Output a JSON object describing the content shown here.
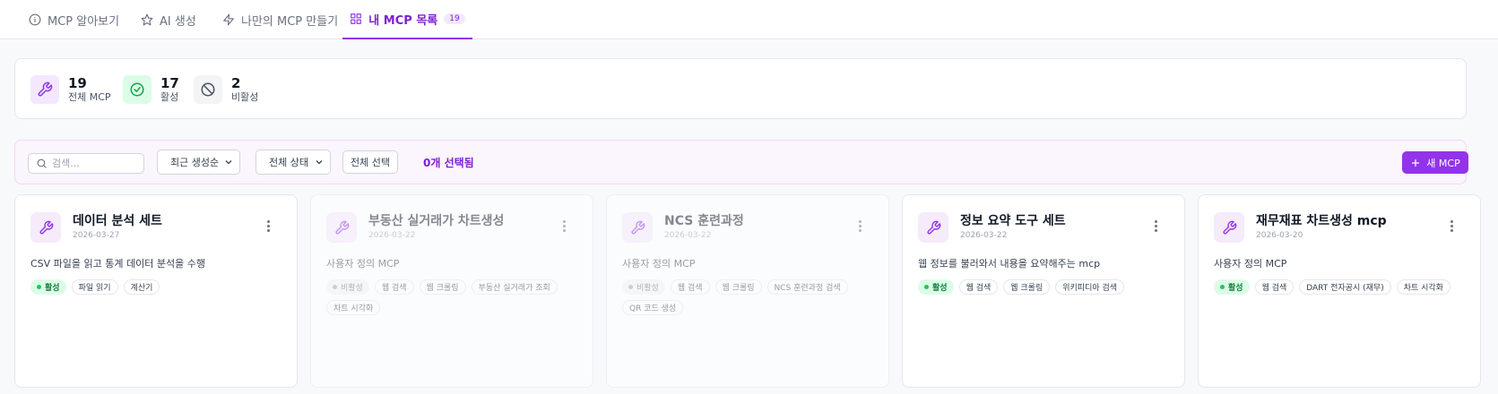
{
  "tabs": [
    {
      "label": "MCP 알아보기",
      "icon": "info-icon"
    },
    {
      "label": "AI 생성",
      "icon": "star-icon"
    },
    {
      "label": "나만의 MCP 만들기",
      "icon": "lightning-icon"
    },
    {
      "label": "내 MCP 목록",
      "icon": "grid-icon",
      "badge": "19",
      "active": true
    }
  ],
  "stats": [
    {
      "value": "19",
      "label": "전체 MCP",
      "icon": "wrench-icon",
      "color": "#9333ea"
    },
    {
      "value": "17",
      "label": "활성",
      "icon": "check-circle-icon",
      "color": "#16a34a"
    },
    {
      "value": "2",
      "label": "비활성",
      "icon": "ban-icon",
      "color": "#6b7280"
    }
  ],
  "filters": {
    "search_placeholder": "검색...",
    "sort_value": "최근 생성순",
    "status_value": "전체 상태",
    "select_all_label": "전체 선택",
    "selected_count": "0개 선택됨",
    "new_button_label": "새 MCP"
  },
  "cards": [
    {
      "title": "데이터 분석 세트",
      "date": "2026-03-27",
      "description": "CSV 파일을 읽고 통계 데이터 분석을 수행",
      "status": "활성",
      "active": true,
      "tags": [
        "파일 읽기",
        "계산기"
      ]
    },
    {
      "title": "부동산 실거래가 차트생성",
      "date": "2026-03-22",
      "description": "사용자 정의 MCP",
      "status": "비활성",
      "active": false,
      "tags": [
        "웹 검색",
        "웹 크롤링",
        "부동산 실거래가 조회",
        "차트 시각화"
      ]
    },
    {
      "title": "NCS 훈련과정",
      "date": "2026-03-22",
      "description": "사용자 정의 MCP",
      "status": "비활성",
      "active": false,
      "tags": [
        "웹 검색",
        "웹 크롤링",
        "NCS 훈련과정 검색",
        "QR 코드 생성"
      ]
    },
    {
      "title": "정보 요약 도구 세트",
      "date": "2026-03-22",
      "description": "웹 정보를 불러와서 내용을 요약해주는 mcp",
      "status": "활성",
      "active": true,
      "tags": [
        "웹 검색",
        "웹 크롤링",
        "위키피디아 검색"
      ]
    },
    {
      "title": "재무재표 차트생성 mcp",
      "date": "2026-03-20",
      "description": "사용자 정의 MCP",
      "status": "활성",
      "active": true,
      "tags": [
        "웹 검색",
        "DART 전자공시 (재무)",
        "차트 시각화"
      ]
    }
  ],
  "colors": {
    "accent": "#9333ea",
    "active_green": "#16a34a",
    "inactive_gray": "#6b7280"
  }
}
